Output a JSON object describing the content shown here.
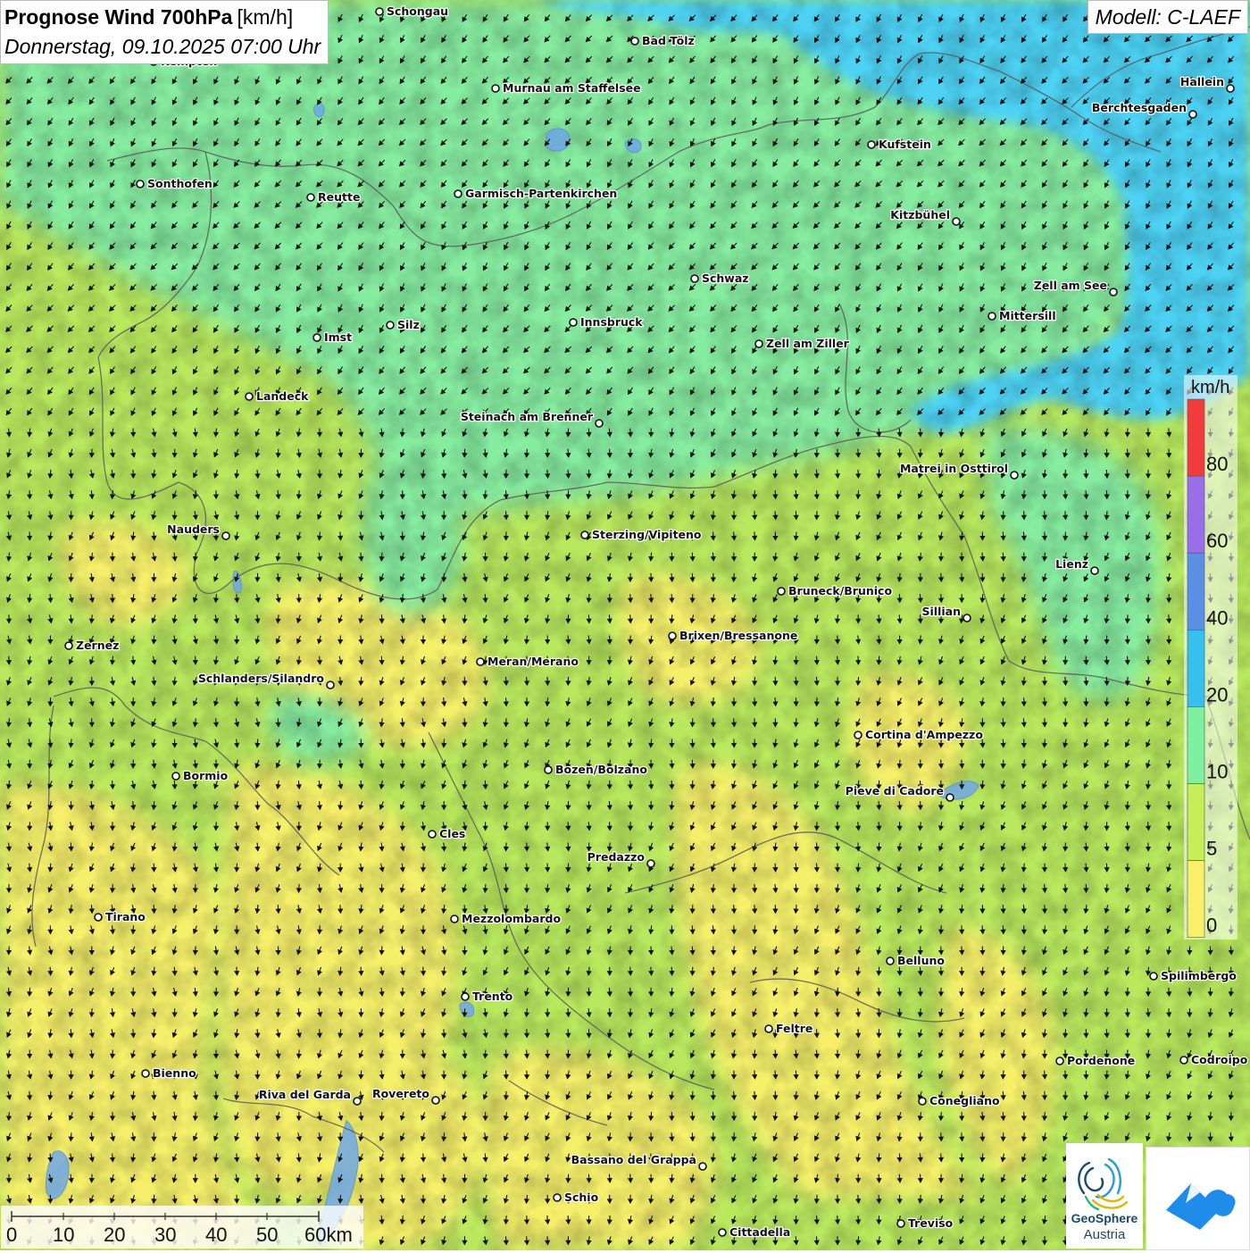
{
  "title": {
    "main": "Prognose Wind 700hPa",
    "unit": "[km/h]",
    "date": "Donnerstag, 09.10.2025 07:00 Uhr"
  },
  "model": "Modell: C-LAEF",
  "legend": {
    "unit": "km/h",
    "classes": [
      {
        "from": 80,
        "to": 100,
        "color": "#f03c3c"
      },
      {
        "from": 60,
        "to": 80,
        "color": "#9a6ee8"
      },
      {
        "from": 40,
        "to": 60,
        "color": "#5b8fe6"
      },
      {
        "from": 20,
        "to": 40,
        "color": "#37bfee"
      },
      {
        "from": 10,
        "to": 20,
        "color": "#7fefa0"
      },
      {
        "from": 5,
        "to": 10,
        "color": "#c5ee58"
      },
      {
        "from": 0,
        "to": 5,
        "color": "#f8f06a"
      }
    ],
    "labels": [
      "80",
      "60",
      "40",
      "20",
      "10",
      "5",
      "0"
    ]
  },
  "scale": {
    "labels": [
      "0",
      "10",
      "20",
      "30",
      "40",
      "50",
      "60km"
    ]
  },
  "logos": {
    "left_line1": "GeoSphere",
    "left_line2": "Austria"
  },
  "cities": [
    {
      "name": "Schongau",
      "side": "r"
    },
    {
      "name": "Bad Tölz",
      "side": "r"
    },
    {
      "name": "Kempten",
      "side": "r"
    },
    {
      "name": "Murnau am Staffelsee",
      "side": "r"
    },
    {
      "name": "Hallein",
      "side": "l"
    },
    {
      "name": "Berchtesgaden",
      "side": "l"
    },
    {
      "name": "Kufstein",
      "side": "r"
    },
    {
      "name": "Sonthofen",
      "side": "r"
    },
    {
      "name": "Reutte",
      "side": "r"
    },
    {
      "name": "Garmisch-Partenkirchen",
      "side": "r"
    },
    {
      "name": "Kitzbühel",
      "side": "l"
    },
    {
      "name": "Schwaz",
      "side": "r"
    },
    {
      "name": "Zell am See",
      "side": "l"
    },
    {
      "name": "Mittersill",
      "side": "r"
    },
    {
      "name": "Innsbruck",
      "side": "r"
    },
    {
      "name": "Silz",
      "side": "r"
    },
    {
      "name": "Imst",
      "side": "r"
    },
    {
      "name": "Zell am Ziller",
      "side": "r"
    },
    {
      "name": "Landeck",
      "side": "r"
    },
    {
      "name": "Steinach am Brenner",
      "side": "l"
    },
    {
      "name": "Matrei in Osttirol",
      "side": "l"
    },
    {
      "name": "Nauders",
      "side": "l"
    },
    {
      "name": "Sterzing/Vipiteno",
      "side": "r"
    },
    {
      "name": "Lienz",
      "side": "l"
    },
    {
      "name": "Bruneck/Brunico",
      "side": "r"
    },
    {
      "name": "Sillian",
      "side": "l"
    },
    {
      "name": "Zernez",
      "side": "r"
    },
    {
      "name": "Brixen/Bressanone",
      "side": "r"
    },
    {
      "name": "Meran/Merano",
      "side": "r"
    },
    {
      "name": "Schlanders/Silandro",
      "side": "l"
    },
    {
      "name": "Cortina d'Ampezzo",
      "side": "r"
    },
    {
      "name": "Bozen/Bolzano",
      "side": "r"
    },
    {
      "name": "Bormio",
      "side": "r"
    },
    {
      "name": "Pieve di Cadore",
      "side": "l"
    },
    {
      "name": "Cles",
      "side": "r"
    },
    {
      "name": "Predazzo",
      "side": "l"
    },
    {
      "name": "Tirano",
      "side": "r"
    },
    {
      "name": "Mezzolombardo",
      "side": "r"
    },
    {
      "name": "Belluno",
      "side": "r"
    },
    {
      "name": "Spilimbergo",
      "side": "r"
    },
    {
      "name": "Trento",
      "side": "r"
    },
    {
      "name": "Feltre",
      "side": "r"
    },
    {
      "name": "Pordenone",
      "side": "r"
    },
    {
      "name": "Codroipo",
      "side": "r"
    },
    {
      "name": "Bienno",
      "side": "r"
    },
    {
      "name": "Riva del Garda",
      "side": "l"
    },
    {
      "name": "Rovereto",
      "side": "l"
    },
    {
      "name": "Conegliano",
      "side": "r"
    },
    {
      "name": "Bassano del Grappa",
      "side": "l"
    },
    {
      "name": "Schio",
      "side": "r"
    },
    {
      "name": "Treviso",
      "side": "r"
    },
    {
      "name": "Cittadella",
      "side": "r"
    }
  ]
}
